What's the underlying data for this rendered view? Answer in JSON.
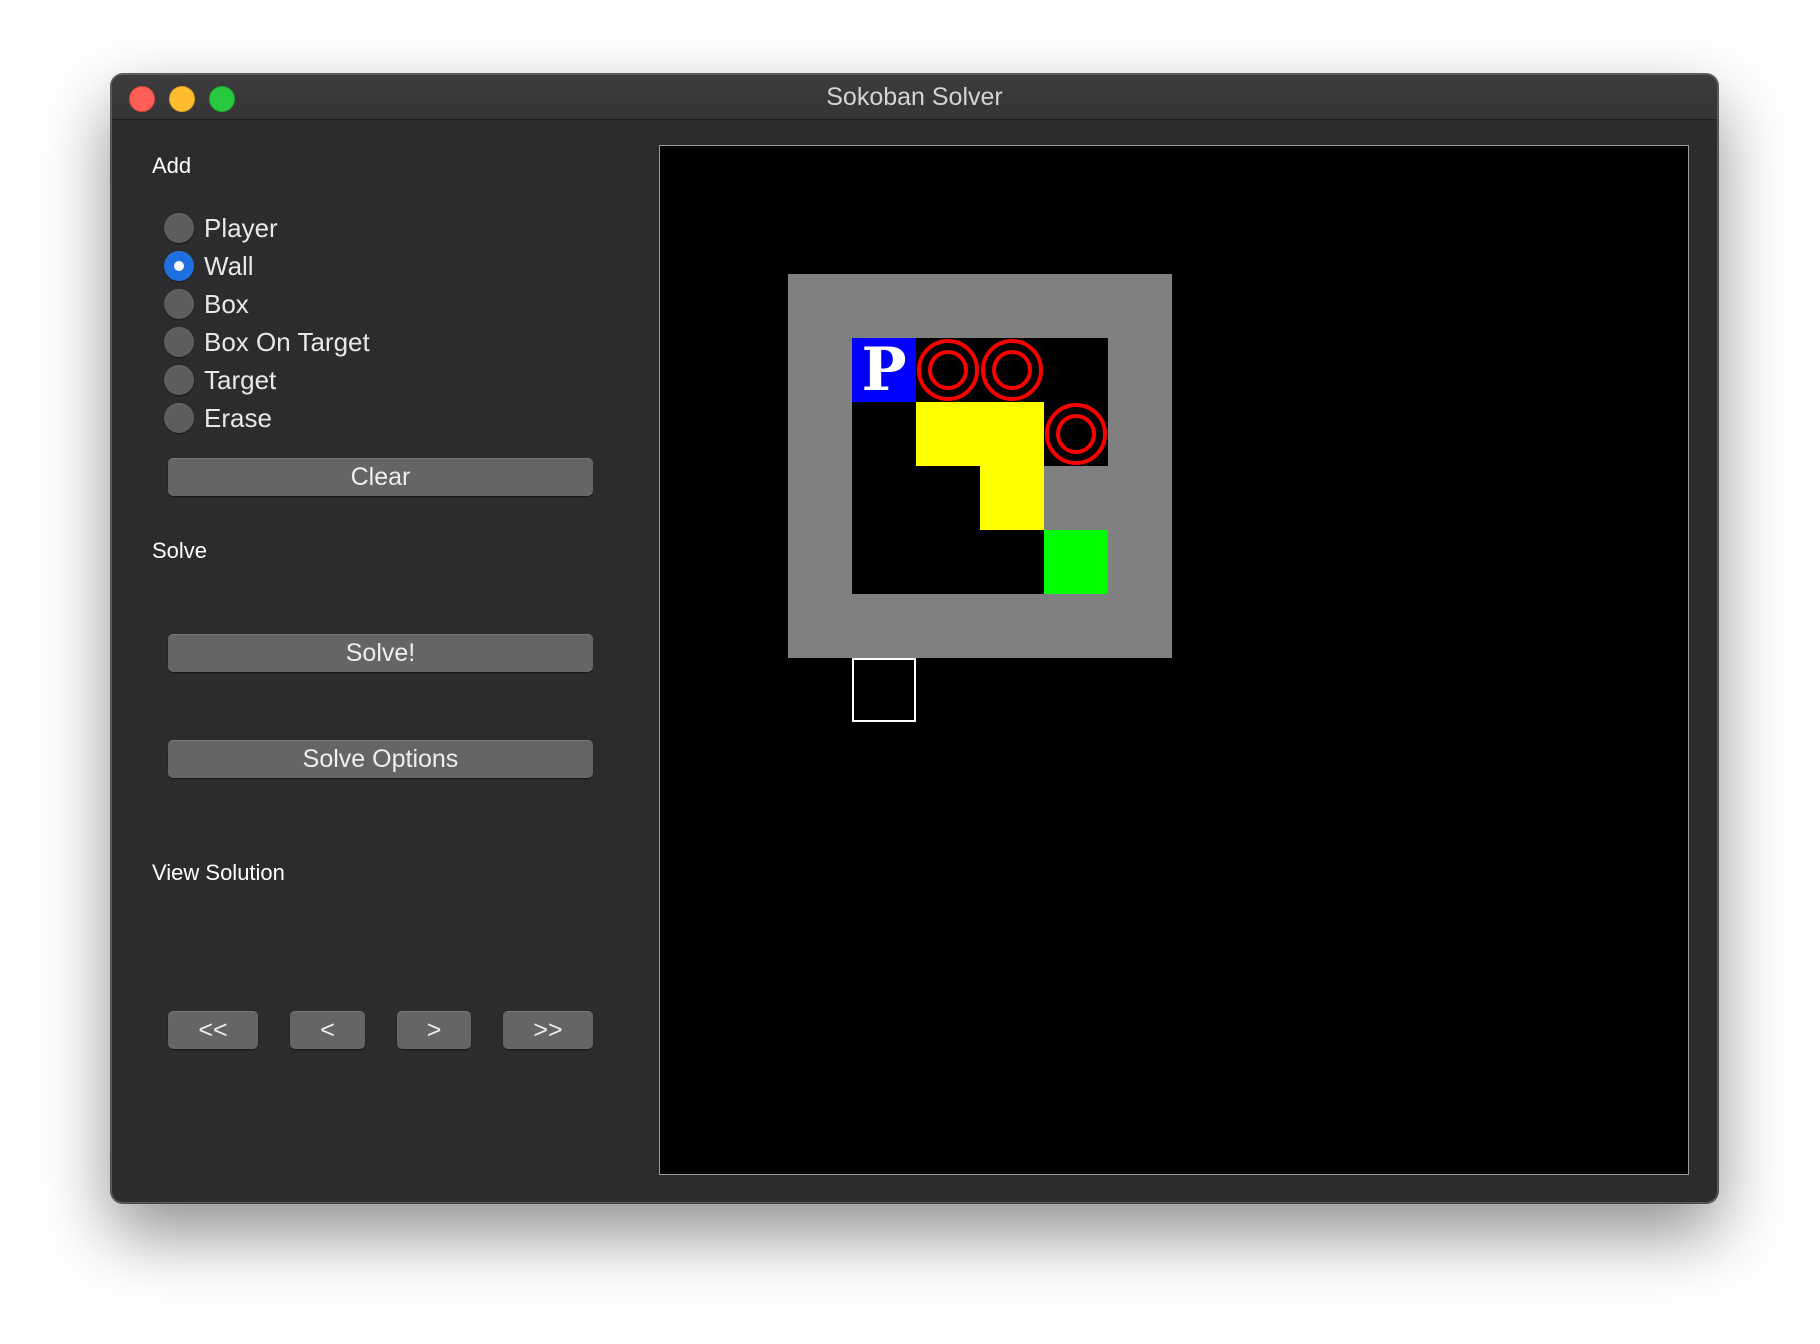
{
  "window": {
    "title": "Sokoban Solver"
  },
  "add_section": {
    "label": "Add",
    "options": [
      {
        "label": "Player",
        "checked": false
      },
      {
        "label": "Wall",
        "checked": true
      },
      {
        "label": "Box",
        "checked": false
      },
      {
        "label": "Box On Target",
        "checked": false
      },
      {
        "label": "Target",
        "checked": false
      },
      {
        "label": "Erase",
        "checked": false
      }
    ],
    "clear_label": "Clear"
  },
  "solve_section": {
    "label": "Solve",
    "solve_label": "Solve!",
    "options_label": "Solve Options"
  },
  "view_section": {
    "label": "View Solution",
    "first_label": "<<",
    "prev_label": "<",
    "next_label": ">",
    "last_label": ">>"
  },
  "board": {
    "grid": [
      "WWWWWW",
      "WPTT.W",
      "W.BBTW",
      "W..BWW",
      "W...GW",
      "WWWWWW"
    ],
    "legend": {
      "W": "wall",
      "P": "player",
      "T": "target",
      "B": "box",
      "G": "box-on-target",
      ".": "floor"
    },
    "player_glyph": "P",
    "cursor_cell": {
      "row": 6,
      "col": 1
    },
    "colors": {
      "wall": "#808080",
      "player": "#0000ff",
      "target": "#ff0000",
      "box": "#ffff00",
      "box_on_target": "#00ff00",
      "floor": "#000000",
      "cursor": "#ffffff"
    }
  }
}
